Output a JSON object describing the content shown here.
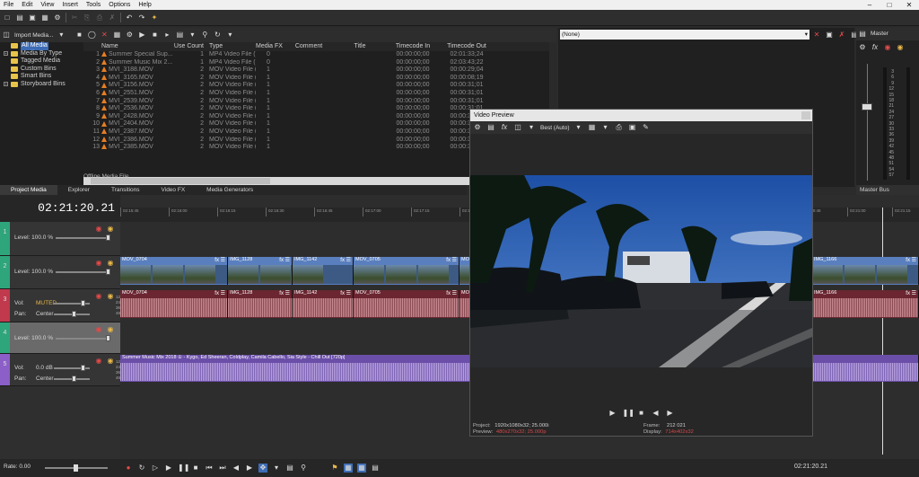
{
  "menu": [
    "File",
    "Edit",
    "View",
    "Insert",
    "Tools",
    "Options",
    "Help"
  ],
  "explorer": {
    "import_label": "Import Media...",
    "tree": [
      {
        "label": "All Media",
        "selected": true,
        "expander": ""
      },
      {
        "label": "Media By Type",
        "expander": "+"
      },
      {
        "label": "Tagged Media",
        "expander": ""
      },
      {
        "label": "Custom Bins",
        "expander": ""
      },
      {
        "label": "Smart Bins",
        "expander": ""
      },
      {
        "label": "Storyboard Bins",
        "expander": "+"
      }
    ],
    "columns": [
      "",
      "Name",
      "Use Count",
      "Type",
      "Media FX",
      "Comment",
      "Title",
      "Timecode In",
      "Timecode Out"
    ],
    "rows": [
      [
        "1",
        "Summer Special Sup...",
        "1",
        "MP4 Video File (V...",
        "0",
        "",
        "",
        "00:00:00;00",
        "02:01:33;24"
      ],
      [
        "2",
        "Summer Music Mix 2...",
        "1",
        "MP4 Video File (V...",
        "0",
        "",
        "",
        "00:00:00;00",
        "02:03:43;22"
      ],
      [
        "3",
        "MVI_3188.MOV",
        "2",
        "MOV Video File (V...",
        "1",
        "",
        "",
        "00:00:00;00",
        "00:00:29;04"
      ],
      [
        "4",
        "MVI_3165.MOV",
        "2",
        "MOV Video File (V...",
        "1",
        "",
        "",
        "00:00:00;00",
        "00:00:08;19"
      ],
      [
        "5",
        "MVI_3156.MOV",
        "2",
        "MOV Video File (V...",
        "1",
        "",
        "",
        "00:00:00;00",
        "00:00:31;01"
      ],
      [
        "6",
        "MVI_2551.MOV",
        "2",
        "MOV Video File (V...",
        "1",
        "",
        "",
        "00:00:00;00",
        "00:00:31;01"
      ],
      [
        "7",
        "MVI_2539.MOV",
        "2",
        "MOV Video File (V...",
        "1",
        "",
        "",
        "00:00:00;00",
        "00:00:31;01"
      ],
      [
        "8",
        "MVI_2536.MOV",
        "2",
        "MOV Video File (V...",
        "1",
        "",
        "",
        "00:00:00;00",
        "00:00:31;01"
      ],
      [
        "9",
        "MVI_2428.MOV",
        "2",
        "MOV Video File (V...",
        "1",
        "",
        "",
        "00:00:00;00",
        "00:00:31;01"
      ],
      [
        "10",
        "MVI_2404.MOV",
        "2",
        "MOV Video File (V...",
        "1",
        "",
        "",
        "00:00:00;00",
        "00:00:31;01"
      ],
      [
        "11",
        "MVI_2387.MOV",
        "2",
        "MOV Video File (V...",
        "1",
        "",
        "",
        "00:00:00;00",
        "00:00:31;01"
      ],
      [
        "12",
        "MVI_2386.MOV",
        "2",
        "MOV Video File (V...",
        "1",
        "",
        "",
        "00:00:00;00",
        "00:00:31;01"
      ],
      [
        "13",
        "MVI_2385.MOV",
        "2",
        "MOV Video File (V...",
        "1",
        "",
        "",
        "00:00:00;00",
        "00:00:31;01"
      ]
    ],
    "offline_label": "Offline Media File"
  },
  "tabs": [
    "Project Media",
    "Explorer",
    "Transitions",
    "Video FX",
    "Media Generators"
  ],
  "trimmer": {
    "selector_value": "(None)"
  },
  "master": {
    "title": "Master",
    "bus_label": "Master Bus",
    "ticks": [
      "3",
      "6",
      "9",
      "12",
      "15",
      "18",
      "21",
      "24",
      "27",
      "30",
      "33",
      "36",
      "39",
      "42",
      "45",
      "48",
      "51",
      "54",
      "57"
    ]
  },
  "timeline": {
    "timecode": "02:21:20.21",
    "ruler": [
      "02:15:45",
      "02:16:00",
      "02:16:15",
      "02:16:30",
      "02:16:45",
      "02:17:00",
      "02:17:15",
      "02:17:30",
      "02:17:45",
      "02:18:00",
      "02:18:15",
      "02:18:30",
      "02:20:45",
      "02:21:00",
      "02:21:15"
    ],
    "tracks": [
      {
        "num": "1",
        "level": "Level: 100.0 %"
      },
      {
        "num": "2",
        "level": "Level: 100.0 %"
      },
      {
        "num": "3",
        "vol_label": "Vol:",
        "vol": "MUTED",
        "pan_label": "Pan:",
        "pan": "Center"
      },
      {
        "num": "4",
        "level": "Level: 100.0 %"
      },
      {
        "num": "5",
        "vol_label": "Vol:",
        "vol": "0.0 dB",
        "pan_label": "Pan:",
        "pan": "Center"
      }
    ],
    "video_clips": [
      "MOV_0704",
      "IMG_1128",
      "IMG_1142",
      "MOV_0705",
      "MOV_0...",
      "IMG_1166"
    ],
    "audio_clips": [
      "MOV_0704",
      "IMG_1128",
      "IMG_1142",
      "MOV_0705",
      "MOV_0708",
      "IMG_1166"
    ],
    "music_clip": "Summer Music Mix 2018 ① - Kygo, Ed Sheeran, Coldplay, Camila Cabello, Sia Style - Chill Out [720p]",
    "db_ticks": [
      "12",
      "24",
      "36",
      "48"
    ]
  },
  "transport": {
    "rate": "Rate: 0.00",
    "end_time": "02:21:20.21"
  },
  "video_preview": {
    "title": "Video Preview",
    "quality": "Best (Auto)",
    "project_label": "Project:",
    "project_value": "1920x1080x32; 25.000i",
    "preview_label": "Preview:",
    "preview_value": "480x270x32; 25.000p",
    "frame_label": "Frame:",
    "frame_value": "212 021",
    "display_label": "Display:",
    "display_value": "714x402x32"
  }
}
